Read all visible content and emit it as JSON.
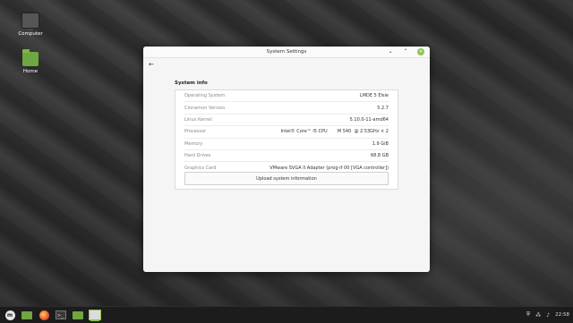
{
  "desktop": {
    "icons": [
      {
        "label": "Computer",
        "icon": "computer-icon"
      },
      {
        "label": "Home",
        "icon": "home-folder-icon"
      }
    ]
  },
  "window": {
    "title": "System Settings",
    "controls": {
      "minimize": "⌄",
      "maximize": "⌃",
      "close": "✕"
    },
    "back": "←"
  },
  "system_info": {
    "heading": "System info",
    "rows": [
      {
        "key": "Operating System",
        "value": "LMDE 5 Elsie"
      },
      {
        "key": "Cinnamon Version",
        "value": "5.2.7"
      },
      {
        "key": "Linux Kernel",
        "value": "5.10.0-11-amd64"
      },
      {
        "key": "Processor",
        "value": "Intel© Core™ i5 CPU       M 540  @ 2.53GHz × 2"
      },
      {
        "key": "Memory",
        "value": "1.9 GiB"
      },
      {
        "key": "Hard Drives",
        "value": "68.8 GB"
      },
      {
        "key": "Graphics Card",
        "value": "VMware SVGA II Adapter (prog-if 00 [VGA controller])"
      }
    ],
    "upload_label": "Upload system information"
  },
  "taskbar": {
    "terminal_glyph": ">_",
    "clock": "22:58"
  },
  "colors": {
    "accent": "#8fc550",
    "taskbar": "#1c1c1c"
  }
}
